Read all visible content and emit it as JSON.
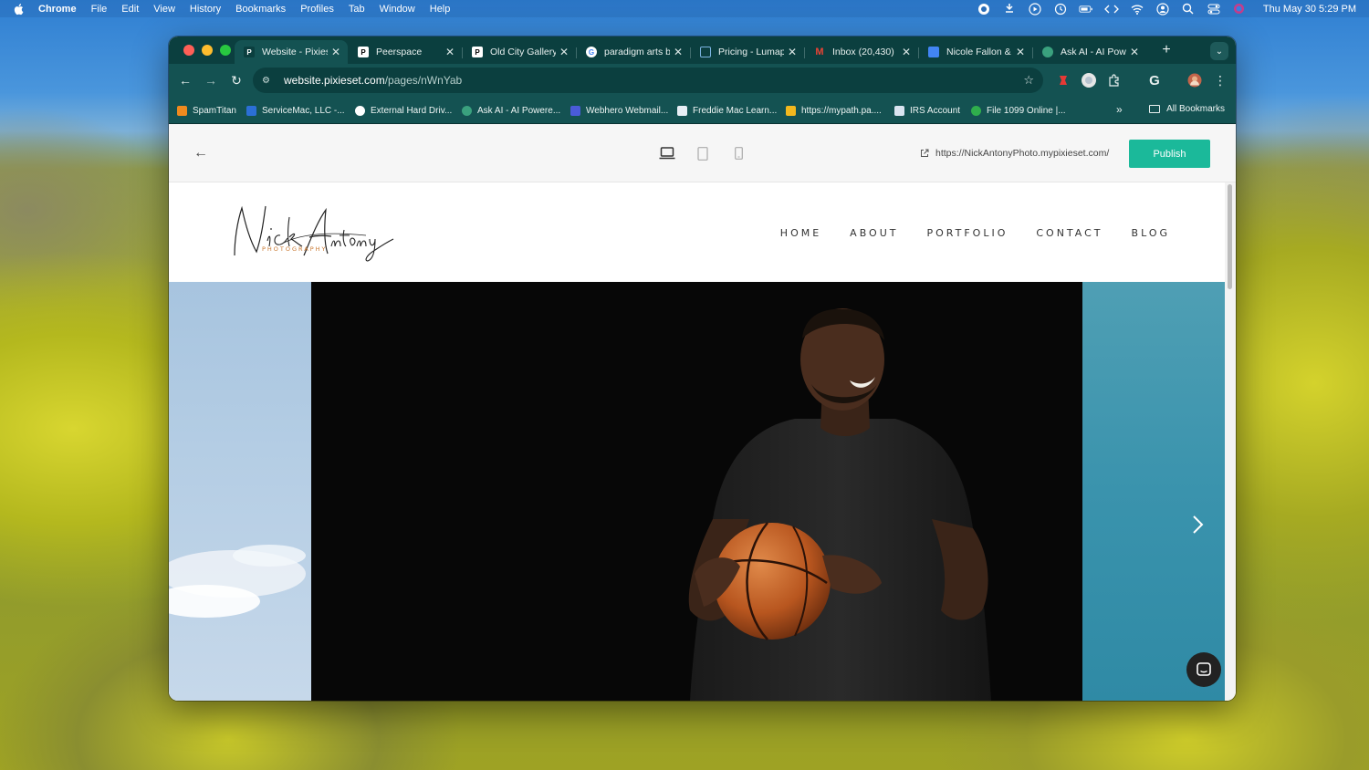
{
  "menubar": {
    "app": "Chrome",
    "items": [
      "File",
      "Edit",
      "View",
      "History",
      "Bookmarks",
      "Profiles",
      "Tab",
      "Window",
      "Help"
    ],
    "clock": "Thu May 30  5:29 PM"
  },
  "tabs": [
    {
      "title": "Website - Pixieset",
      "favicon": "pixieset-icon",
      "active": true
    },
    {
      "title": "Peerspace",
      "favicon": "peerspace-icon",
      "active": false
    },
    {
      "title": "Old City Gallery",
      "favicon": "peerspace-icon",
      "active": false
    },
    {
      "title": "paradigm arts b",
      "favicon": "google-icon",
      "active": false
    },
    {
      "title": "Pricing - Lumap",
      "favicon": "lumapix-icon",
      "active": false
    },
    {
      "title": "Inbox (20,430)",
      "favicon": "gmail-icon",
      "active": false
    },
    {
      "title": "Nicole Fallon &",
      "favicon": "docs-icon",
      "active": false
    },
    {
      "title": "Ask AI - AI Pow",
      "favicon": "ask-ai-icon",
      "active": false
    }
  ],
  "address_bar": {
    "host": "website.pixieset.com",
    "path": "/pages/nWnYab"
  },
  "bookmarks": [
    {
      "label": "SpamTitan",
      "color": "#f08a1e"
    },
    {
      "label": "ServiceMac, LLC -...",
      "color": "#2b6fd6"
    },
    {
      "label": "External Hard Driv...",
      "color": "#ffffff"
    },
    {
      "label": "Ask AI - AI Powere...",
      "color": "#3aa17e"
    },
    {
      "label": "Webhero Webmail...",
      "color": "#4a5bd8"
    },
    {
      "label": "Freddie Mac Learn...",
      "color": "#e8eef5"
    },
    {
      "label": "https://mypath.pa....",
      "color": "#f2b81e"
    },
    {
      "label": "IRS Account",
      "color": "#d9e4f0"
    },
    {
      "label": "File 1099 Online |...",
      "color": "#2fae4c"
    }
  ],
  "all_bookmarks_label": "All Bookmarks",
  "editor": {
    "site_url": "https://NickAntonyPhoto.mypixieset.com/",
    "publish_label": "Publish"
  },
  "site": {
    "logo_text": "Nick Antony",
    "logo_sub": "PHOTOGRAPHY",
    "nav": [
      "HOME",
      "ABOUT",
      "PORTFOLIO",
      "CONTACT",
      "BLOG"
    ]
  },
  "colors": {
    "chrome_dark": "#0b3f3f",
    "chrome_toolbar": "#145252",
    "publish_green": "#1bb99a",
    "logo_accent": "#c8752c"
  }
}
